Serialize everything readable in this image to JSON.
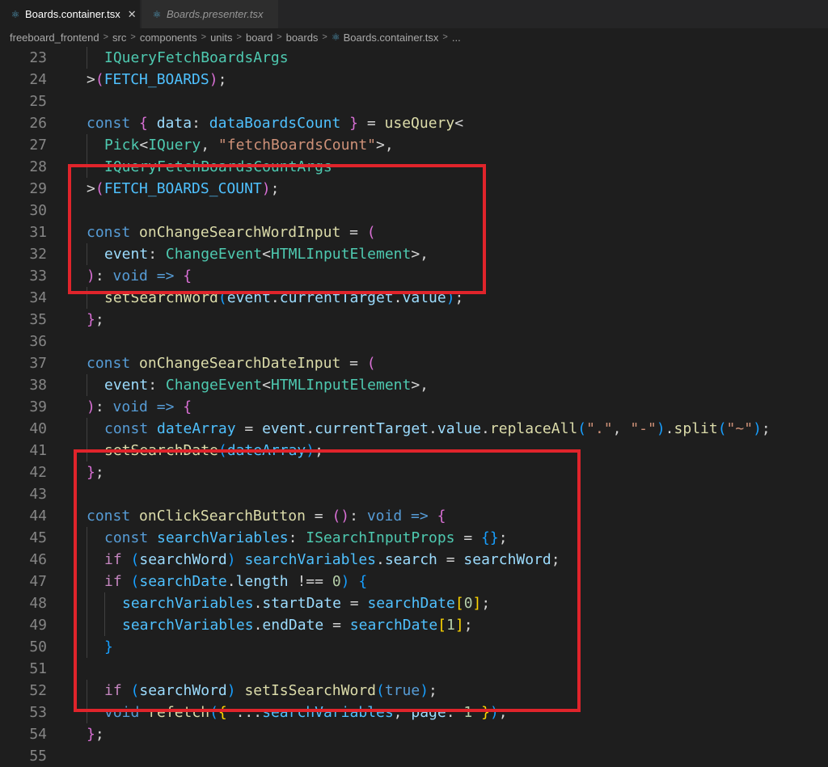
{
  "tabs": [
    {
      "label": "Boards.container.tsx",
      "icon": "react-icon",
      "active": true,
      "close": "✕"
    },
    {
      "label": "Boards.presenter.tsx",
      "icon": "react-icon",
      "active": false
    }
  ],
  "breadcrumb": {
    "items": [
      "freeboard_frontend",
      "src",
      "components",
      "units",
      "board",
      "boards",
      "Boards.container.tsx",
      "..."
    ],
    "separator": ">"
  },
  "colors": {
    "keyword": "#569cd6",
    "control": "#c586c0",
    "function": "#dcdcaa",
    "type": "#4ec9b0",
    "variable": "#9cdcfe",
    "constant": "#4fc1ff",
    "string": "#ce9178",
    "number": "#b5cea8",
    "bracket_gold": "#ffd700",
    "bracket_purple": "#da70d6",
    "bracket_blue": "#179fff",
    "highlight_border": "#e0242b"
  },
  "lines": [
    {
      "n": "23",
      "indent": 1,
      "t": [
        [
          "IQueryFetchBoardsArgs",
          "type"
        ]
      ]
    },
    {
      "n": "24",
      "indent": 0,
      "t": [
        [
          ">",
          "plain"
        ],
        [
          "(",
          "bp"
        ],
        [
          "FETCH_BOARDS",
          "const"
        ],
        [
          ")",
          "bp"
        ],
        [
          ";",
          "plain"
        ]
      ]
    },
    {
      "n": "25",
      "indent": 0,
      "t": []
    },
    {
      "n": "26",
      "indent": 0,
      "t": [
        [
          "const",
          "kw"
        ],
        [
          " ",
          "plain"
        ],
        [
          "{",
          "bp"
        ],
        [
          " ",
          "plain"
        ],
        [
          "data",
          "var"
        ],
        [
          ": ",
          "plain"
        ],
        [
          "dataBoardsCount",
          "const"
        ],
        [
          " ",
          "plain"
        ],
        [
          "}",
          "bp"
        ],
        [
          " = ",
          "plain"
        ],
        [
          "useQuery",
          "fn"
        ],
        [
          "<",
          "plain"
        ]
      ]
    },
    {
      "n": "27",
      "indent": 1,
      "t": [
        [
          "Pick",
          "type"
        ],
        [
          "<",
          "plain"
        ],
        [
          "IQuery",
          "type"
        ],
        [
          ", ",
          "plain"
        ],
        [
          "\"fetchBoardsCount\"",
          "str"
        ],
        [
          ">,",
          "plain"
        ]
      ]
    },
    {
      "n": "28",
      "indent": 1,
      "t": [
        [
          "IQueryFetchBoardsCountArgs",
          "type"
        ]
      ]
    },
    {
      "n": "29",
      "indent": 0,
      "t": [
        [
          ">",
          "plain"
        ],
        [
          "(",
          "bp"
        ],
        [
          "FETCH_BOARDS_COUNT",
          "const"
        ],
        [
          ")",
          "bp"
        ],
        [
          ";",
          "plain"
        ]
      ]
    },
    {
      "n": "30",
      "indent": 0,
      "t": []
    },
    {
      "n": "31",
      "indent": 0,
      "t": [
        [
          "const",
          "kw"
        ],
        [
          " ",
          "plain"
        ],
        [
          "onChangeSearchWordInput",
          "fn"
        ],
        [
          " = ",
          "plain"
        ],
        [
          "(",
          "bp"
        ]
      ]
    },
    {
      "n": "32",
      "indent": 1,
      "t": [
        [
          "event",
          "var"
        ],
        [
          ": ",
          "plain"
        ],
        [
          "ChangeEvent",
          "type"
        ],
        [
          "<",
          "plain"
        ],
        [
          "HTMLInputElement",
          "type"
        ],
        [
          ">,",
          "plain"
        ]
      ]
    },
    {
      "n": "33",
      "indent": 0,
      "t": [
        [
          ")",
          "bp"
        ],
        [
          ": ",
          "plain"
        ],
        [
          "void",
          "kw"
        ],
        [
          " ",
          "plain"
        ],
        [
          "=>",
          "kw"
        ],
        [
          " ",
          "plain"
        ],
        [
          "{",
          "bp"
        ]
      ]
    },
    {
      "n": "34",
      "indent": 1,
      "t": [
        [
          "setSearchWord",
          "fn"
        ],
        [
          "(",
          "bb"
        ],
        [
          "event",
          "var"
        ],
        [
          ".",
          "plain"
        ],
        [
          "currentTarget",
          "var"
        ],
        [
          ".",
          "plain"
        ],
        [
          "value",
          "var"
        ],
        [
          ")",
          "bb"
        ],
        [
          ";",
          "plain"
        ]
      ]
    },
    {
      "n": "35",
      "indent": 0,
      "t": [
        [
          "}",
          "bp"
        ],
        [
          ";",
          "plain"
        ]
      ]
    },
    {
      "n": "36",
      "indent": 0,
      "t": []
    },
    {
      "n": "37",
      "indent": 0,
      "t": [
        [
          "const",
          "kw"
        ],
        [
          " ",
          "plain"
        ],
        [
          "onChangeSearchDateInput",
          "fn"
        ],
        [
          " = ",
          "plain"
        ],
        [
          "(",
          "bp"
        ]
      ]
    },
    {
      "n": "38",
      "indent": 1,
      "t": [
        [
          "event",
          "var"
        ],
        [
          ": ",
          "plain"
        ],
        [
          "ChangeEvent",
          "type"
        ],
        [
          "<",
          "plain"
        ],
        [
          "HTMLInputElement",
          "type"
        ],
        [
          ">,",
          "plain"
        ]
      ]
    },
    {
      "n": "39",
      "indent": 0,
      "t": [
        [
          ")",
          "bp"
        ],
        [
          ": ",
          "plain"
        ],
        [
          "void",
          "kw"
        ],
        [
          " ",
          "plain"
        ],
        [
          "=>",
          "kw"
        ],
        [
          " ",
          "plain"
        ],
        [
          "{",
          "bp"
        ]
      ]
    },
    {
      "n": "40",
      "indent": 1,
      "t": [
        [
          "const",
          "kw"
        ],
        [
          " ",
          "plain"
        ],
        [
          "dateArray",
          "const"
        ],
        [
          " = ",
          "plain"
        ],
        [
          "event",
          "var"
        ],
        [
          ".",
          "plain"
        ],
        [
          "currentTarget",
          "var"
        ],
        [
          ".",
          "plain"
        ],
        [
          "value",
          "var"
        ],
        [
          ".",
          "plain"
        ],
        [
          "replaceAll",
          "fn"
        ],
        [
          "(",
          "bb"
        ],
        [
          "\".\"",
          "str"
        ],
        [
          ", ",
          "plain"
        ],
        [
          "\"-\"",
          "str"
        ],
        [
          ")",
          "bb"
        ],
        [
          ".",
          "plain"
        ],
        [
          "split",
          "fn"
        ],
        [
          "(",
          "bb"
        ],
        [
          "\"~\"",
          "str"
        ],
        [
          ")",
          "bb"
        ],
        [
          ";",
          "plain"
        ]
      ]
    },
    {
      "n": "41",
      "indent": 1,
      "t": [
        [
          "setSearchDate",
          "fn"
        ],
        [
          "(",
          "bb"
        ],
        [
          "dateArray",
          "const"
        ],
        [
          ")",
          "bb"
        ],
        [
          ";",
          "plain"
        ]
      ]
    },
    {
      "n": "42",
      "indent": 0,
      "t": [
        [
          "}",
          "bp"
        ],
        [
          ";",
          "plain"
        ]
      ]
    },
    {
      "n": "43",
      "indent": 0,
      "t": []
    },
    {
      "n": "44",
      "indent": 0,
      "t": [
        [
          "const",
          "kw"
        ],
        [
          " ",
          "plain"
        ],
        [
          "onClickSearchButton",
          "fn"
        ],
        [
          " = ",
          "plain"
        ],
        [
          "()",
          "bp"
        ],
        [
          ": ",
          "plain"
        ],
        [
          "void",
          "kw"
        ],
        [
          " ",
          "plain"
        ],
        [
          "=>",
          "kw"
        ],
        [
          " ",
          "plain"
        ],
        [
          "{",
          "bp"
        ]
      ]
    },
    {
      "n": "45",
      "indent": 1,
      "t": [
        [
          "const",
          "kw"
        ],
        [
          " ",
          "plain"
        ],
        [
          "searchVariables",
          "const"
        ],
        [
          ": ",
          "plain"
        ],
        [
          "ISearchInputProps",
          "type"
        ],
        [
          " = ",
          "plain"
        ],
        [
          "{}",
          "bb"
        ],
        [
          ";",
          "plain"
        ]
      ]
    },
    {
      "n": "46",
      "indent": 1,
      "t": [
        [
          "if",
          "ctl"
        ],
        [
          " ",
          "plain"
        ],
        [
          "(",
          "bb"
        ],
        [
          "searchWord",
          "var"
        ],
        [
          ")",
          "bb"
        ],
        [
          " ",
          "plain"
        ],
        [
          "searchVariables",
          "const"
        ],
        [
          ".",
          "plain"
        ],
        [
          "search",
          "var"
        ],
        [
          " = ",
          "plain"
        ],
        [
          "searchWord",
          "var"
        ],
        [
          ";",
          "plain"
        ]
      ]
    },
    {
      "n": "47",
      "indent": 1,
      "t": [
        [
          "if",
          "ctl"
        ],
        [
          " ",
          "plain"
        ],
        [
          "(",
          "bb"
        ],
        [
          "searchDate",
          "const"
        ],
        [
          ".",
          "plain"
        ],
        [
          "length",
          "var"
        ],
        [
          " !== ",
          "plain"
        ],
        [
          "0",
          "num"
        ],
        [
          ")",
          "bb"
        ],
        [
          " ",
          "plain"
        ],
        [
          "{",
          "bb"
        ]
      ]
    },
    {
      "n": "48",
      "indent": 2,
      "t": [
        [
          "searchVariables",
          "const"
        ],
        [
          ".",
          "plain"
        ],
        [
          "startDate",
          "var"
        ],
        [
          " = ",
          "plain"
        ],
        [
          "searchDate",
          "const"
        ],
        [
          "[",
          "bg"
        ],
        [
          "0",
          "num"
        ],
        [
          "]",
          "bg"
        ],
        [
          ";",
          "plain"
        ]
      ]
    },
    {
      "n": "49",
      "indent": 2,
      "t": [
        [
          "searchVariables",
          "const"
        ],
        [
          ".",
          "plain"
        ],
        [
          "endDate",
          "var"
        ],
        [
          " = ",
          "plain"
        ],
        [
          "searchDate",
          "const"
        ],
        [
          "[",
          "bg"
        ],
        [
          "1",
          "num"
        ],
        [
          "]",
          "bg"
        ],
        [
          ";",
          "plain"
        ]
      ]
    },
    {
      "n": "50",
      "indent": 1,
      "t": [
        [
          "}",
          "bb"
        ]
      ]
    },
    {
      "n": "51",
      "indent": 0,
      "t": []
    },
    {
      "n": "52",
      "indent": 1,
      "t": [
        [
          "if",
          "ctl"
        ],
        [
          " ",
          "plain"
        ],
        [
          "(",
          "bb"
        ],
        [
          "searchWord",
          "var"
        ],
        [
          ")",
          "bb"
        ],
        [
          " ",
          "plain"
        ],
        [
          "setIsSearchWord",
          "fn"
        ],
        [
          "(",
          "bb"
        ],
        [
          "true",
          "kw"
        ],
        [
          ")",
          "bb"
        ],
        [
          ";",
          "plain"
        ]
      ]
    },
    {
      "n": "53",
      "indent": 1,
      "t": [
        [
          "void",
          "kw"
        ],
        [
          " ",
          "plain"
        ],
        [
          "refetch",
          "fn"
        ],
        [
          "(",
          "bb"
        ],
        [
          "{",
          "bg"
        ],
        [
          " ...",
          "plain"
        ],
        [
          "searchVariables",
          "const"
        ],
        [
          ", ",
          "plain"
        ],
        [
          "page",
          "var"
        ],
        [
          ": ",
          "plain"
        ],
        [
          "1",
          "num"
        ],
        [
          " ",
          "plain"
        ],
        [
          "}",
          "bg"
        ],
        [
          ")",
          "bb"
        ],
        [
          ";",
          "plain"
        ]
      ]
    },
    {
      "n": "54",
      "indent": 0,
      "t": [
        [
          "}",
          "bp"
        ],
        [
          ";",
          "plain"
        ]
      ]
    },
    {
      "n": "55",
      "indent": 0,
      "t": []
    }
  ]
}
